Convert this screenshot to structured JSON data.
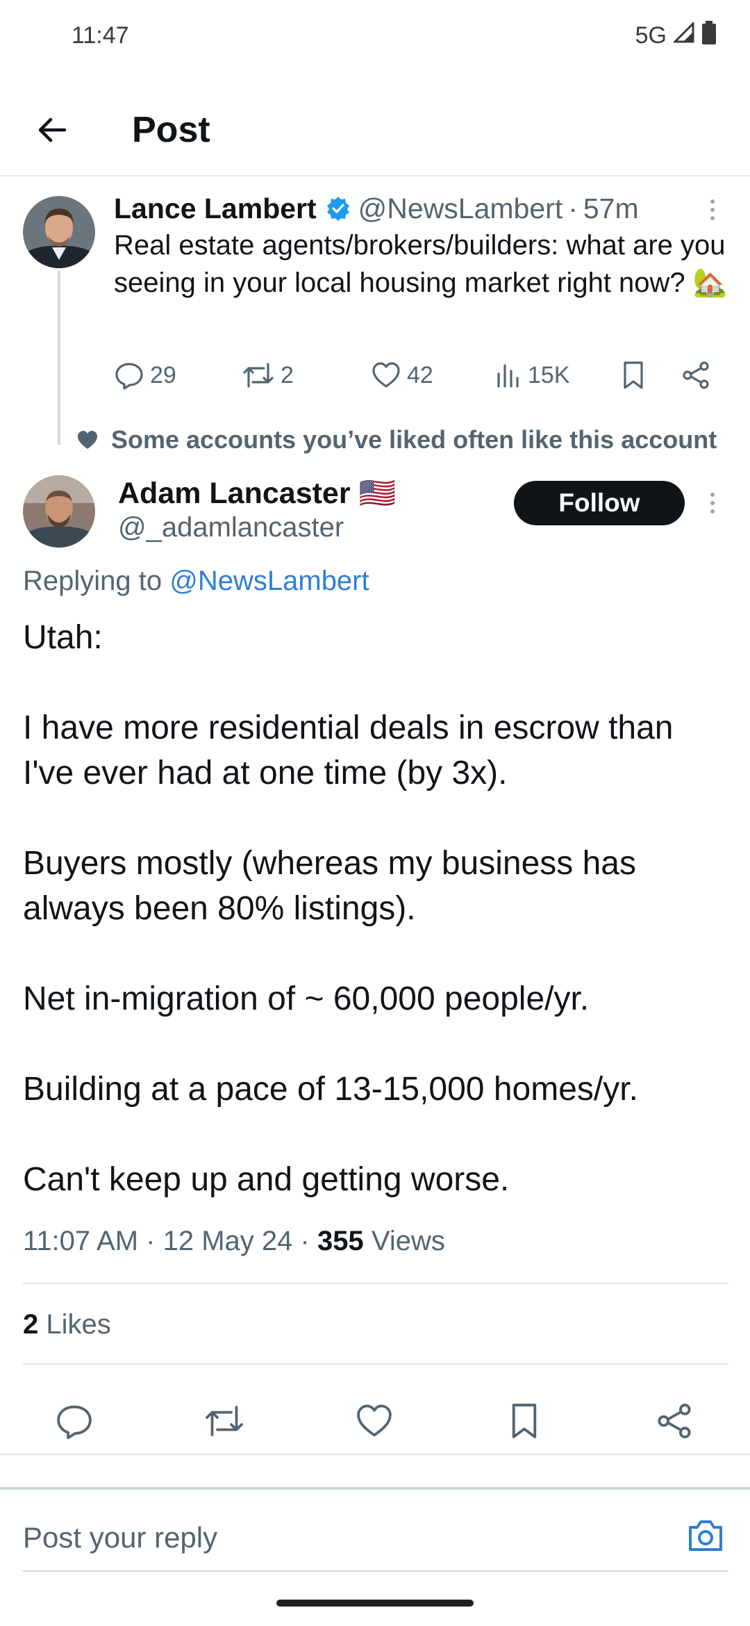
{
  "status_bar": {
    "time": "11:47",
    "network": "5G",
    "icons": [
      "signal-icon",
      "battery-icon"
    ]
  },
  "app_bar": {
    "title": "Post",
    "back_icon": "arrow-left-icon"
  },
  "parent_post": {
    "author_name": "Lance Lambert",
    "verified": true,
    "handle": "@NewsLambert",
    "separator": "·",
    "age": "57m",
    "text": "Real estate agents/brokers/builders: what are you seeing in your local housing market right now? 🏡",
    "stats": {
      "replies": "29",
      "reposts": "2",
      "likes": "42",
      "views": "15K"
    }
  },
  "social_context": {
    "icon": "heart-icon",
    "text": "Some accounts you’ve liked often like this account"
  },
  "reply_post": {
    "author_name": "Adam Lancaster",
    "flag": "🇺🇸",
    "handle": "@_adamlancaster",
    "follow_label": "Follow",
    "replying_prefix": "Replying to",
    "replying_to": "@NewsLambert",
    "paragraphs": [
      "Utah:",
      "",
      "I have more residential deals in escrow than I've ever had at one time (by 3x).",
      "",
      "Buyers mostly (whereas my business has always been 80% listings).",
      "",
      "Net in-migration of ~ 60,000 people/yr.",
      "",
      "Building at a pace of 13-15,000 homes/yr.",
      "",
      "Can't keep up and getting worse."
    ],
    "time": "11:07 AM",
    "date": "12 May 24",
    "separator": "·",
    "views_count": "355",
    "views_label": "Views",
    "likes_count": "2",
    "likes_label": "Likes"
  },
  "composer": {
    "placeholder": "Post your reply",
    "camera_icon": "camera-icon"
  },
  "colors": {
    "text": "#0f1419",
    "secondary": "#536471",
    "link": "#2f7fd1",
    "verified": "#1d9bf0",
    "follow_bg": "#0f1419"
  }
}
